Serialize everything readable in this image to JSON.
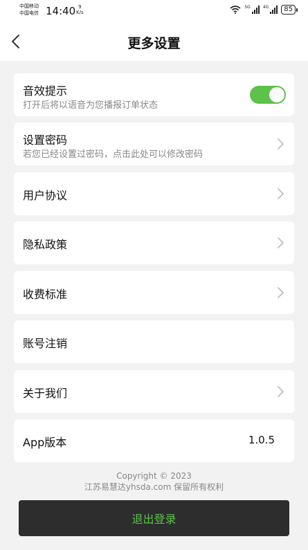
{
  "status_bar": {
    "carrier1": "中国移动",
    "carrier2": "中国电信",
    "time": "14:40",
    "net_speed_value": "9",
    "net_speed_unit": "K/s",
    "sig1_label": "5G",
    "sig2_label": "4G",
    "battery": "85"
  },
  "header": {
    "title": "更多设置"
  },
  "settings": [
    {
      "title": "音效提示",
      "subtitle": "打开后将以语音为您播报订单状态",
      "toggle_on": true
    },
    {
      "title": "设置密码",
      "subtitle": "若您已经设置过密码，点击此处可以修改密码"
    },
    {
      "title": "用户协议"
    },
    {
      "title": "隐私政策"
    },
    {
      "title": "收费标准"
    },
    {
      "title": "账号注销"
    },
    {
      "title": "关于我们"
    },
    {
      "title": "App版本",
      "value": "1.0.5"
    }
  ],
  "footer": {
    "copyright": "Copyright © 2023",
    "company": "江苏易慧达yhsda.com 保留所有权利",
    "logout_label": "退出登录"
  },
  "colors": {
    "accent": "#5cc24a",
    "button_bg": "#2d2d2d",
    "page_bg": "#f2f2f2"
  }
}
